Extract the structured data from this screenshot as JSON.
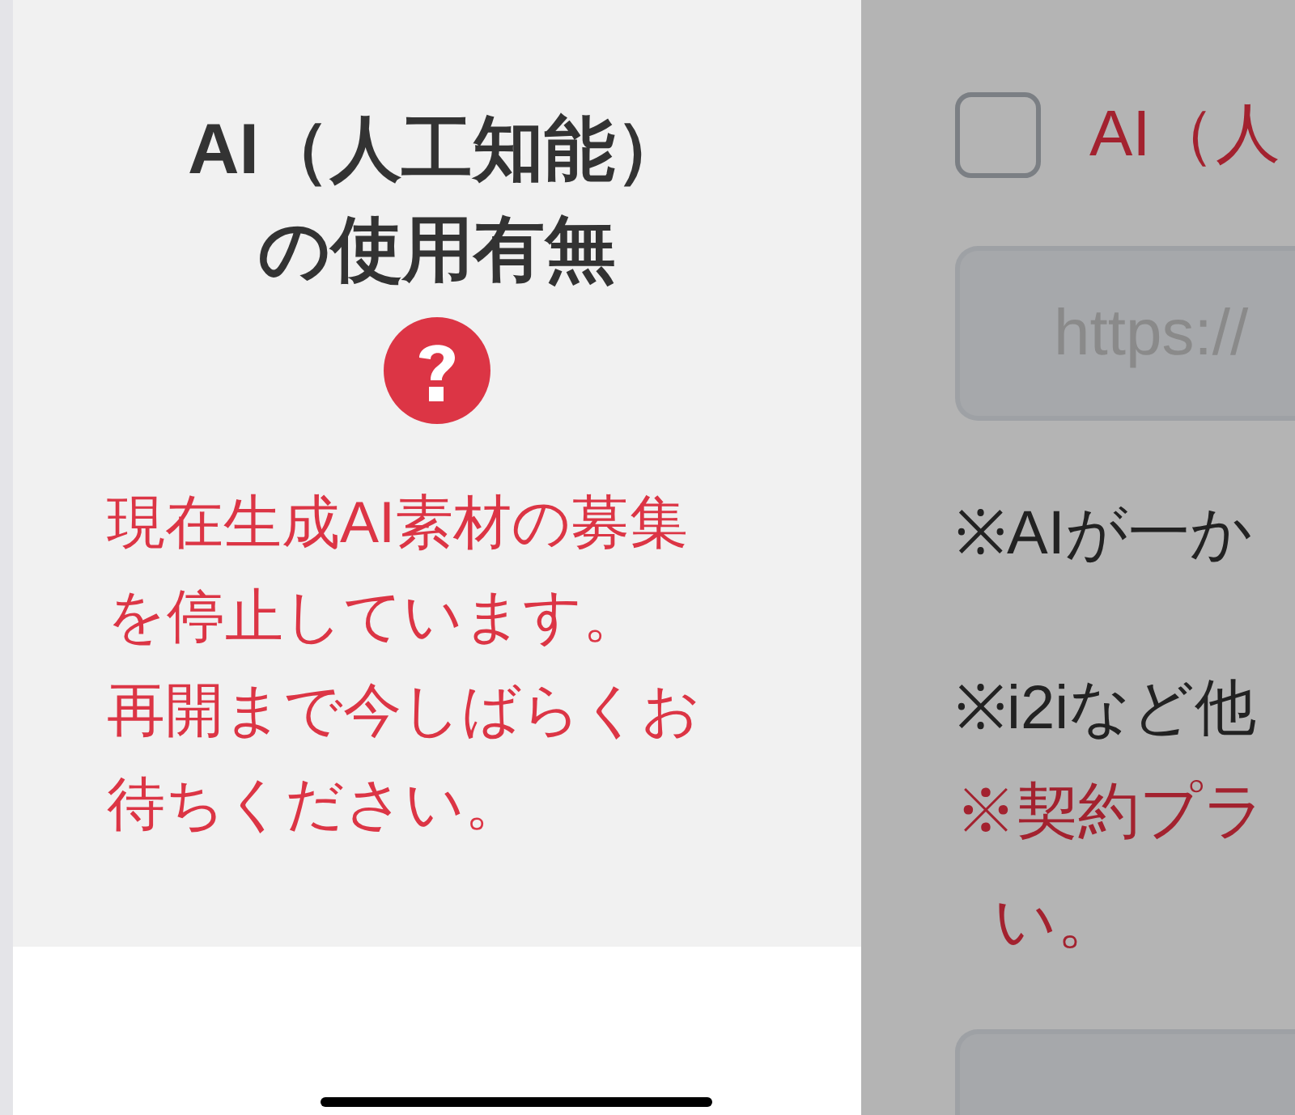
{
  "info_panel": {
    "title": "AI（人工知能）の使用有無",
    "notice_lines": [
      "現在生成AI素材の募集",
      "を停止しています。",
      "再開まで今しばらくお",
      "待ちください。"
    ]
  },
  "form": {
    "disabled": true,
    "checkbox": {
      "label": "AI（人",
      "checked": false
    },
    "url_field": {
      "placeholder": "https://"
    },
    "notes": [
      {
        "text": "※AIが一か",
        "kind": "plain"
      },
      {
        "text": "※i2iなど他",
        "kind": "plain"
      },
      {
        "text": "※契約プラ",
        "kind": "warning"
      },
      {
        "text": "い。",
        "kind": "warning-continued"
      }
    ]
  }
}
